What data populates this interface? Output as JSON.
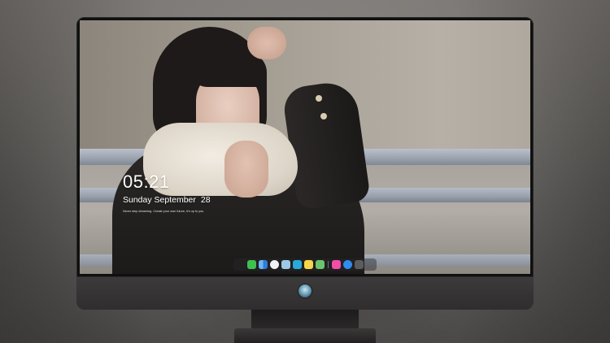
{
  "lock_screen": {
    "time": "05:21",
    "weekday_month": "Sunday September",
    "day": "28",
    "quote": "Never stop dreaming. Create your own future, it's up to you."
  },
  "dock": {
    "items": [
      {
        "name": "messages",
        "icon": "messages-icon",
        "color": "#3fc14f"
      },
      {
        "name": "finder",
        "icon": "finder-icon",
        "color": "#3b8de0"
      },
      {
        "name": "clock",
        "icon": "clock-icon",
        "color": "#f2f2f2"
      },
      {
        "name": "preview",
        "icon": "preview-icon",
        "color": "#9fc7e6"
      },
      {
        "name": "videos",
        "icon": "clapperboard-icon",
        "color": "#28a9d9"
      },
      {
        "name": "notes",
        "icon": "notes-icon",
        "color": "#f7d54a"
      },
      {
        "name": "photos",
        "icon": "photos-icon",
        "color": "#6cc46f"
      },
      {
        "name": "music",
        "icon": "music-icon",
        "color": "#f04ea7"
      },
      {
        "name": "app-store",
        "icon": "app-store-icon",
        "color": "#2f8cf0"
      },
      {
        "name": "camera",
        "icon": "camera-icon",
        "color": "#5c5c5c"
      }
    ]
  }
}
